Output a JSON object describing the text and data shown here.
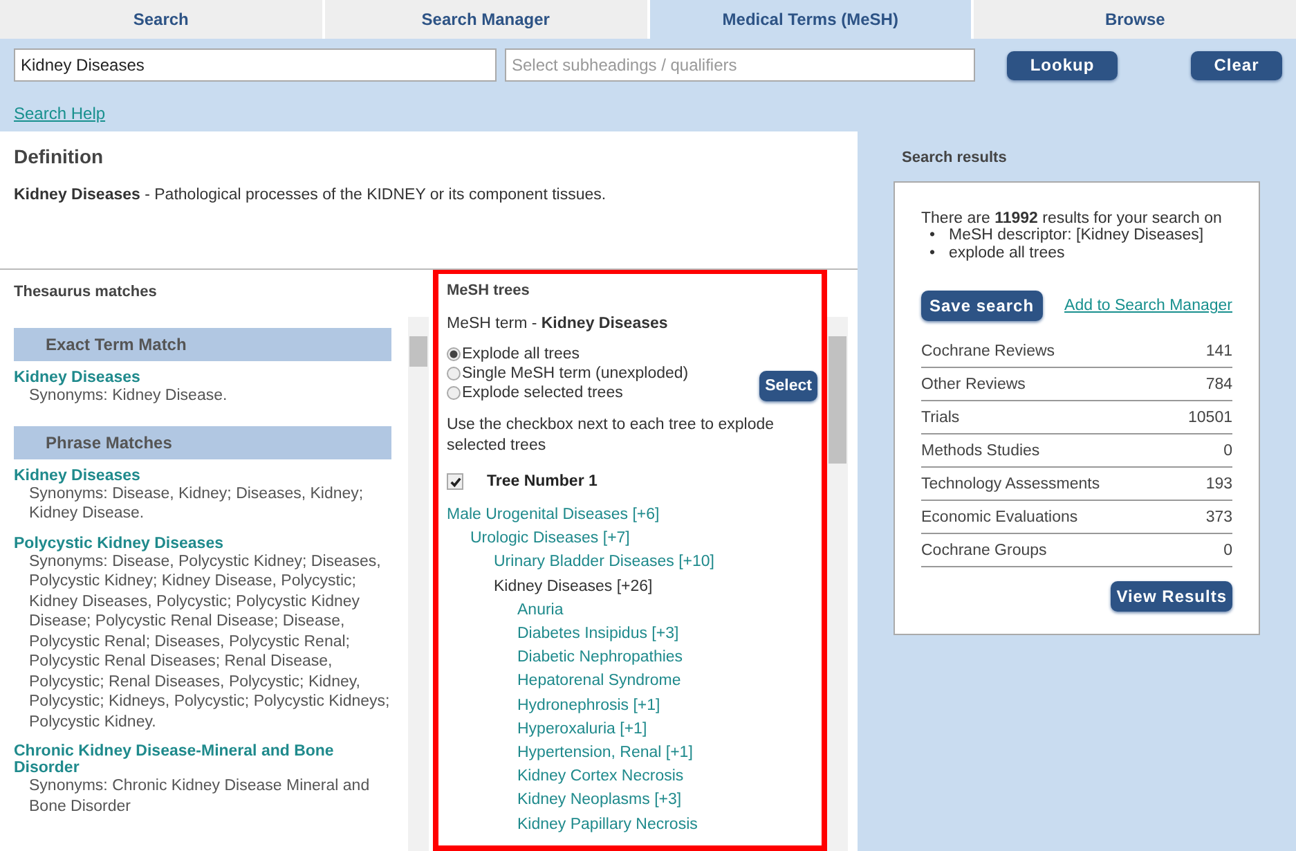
{
  "tabs": [
    {
      "label": "Search",
      "selected": false
    },
    {
      "label": "Search Manager",
      "selected": false
    },
    {
      "label": "Medical Terms (MeSH)",
      "selected": true
    },
    {
      "label": "Browse",
      "selected": false
    }
  ],
  "search": {
    "term": "Kidney Diseases",
    "qualifiers_placeholder": "Select subheadings / qualifiers",
    "lookup": "Lookup",
    "clear": "Clear",
    "help": "Search Help"
  },
  "definition": {
    "title": "Definition",
    "term": "Kidney Diseases",
    "text": " - Pathological processes of the KIDNEY or its component tissues."
  },
  "thesaurus": {
    "title": "Thesaurus matches",
    "groups": [
      {
        "heading": "Exact Term Match",
        "items": [
          {
            "term": "Kidney Diseases",
            "synonyms": "Synonyms: Kidney Disease."
          }
        ]
      },
      {
        "heading": "Phrase Matches",
        "items": [
          {
            "term": "Kidney Diseases",
            "synonyms": "Synonyms: Disease, Kidney; Diseases, Kidney; Kidney Disease."
          },
          {
            "term": "Polycystic Kidney Diseases",
            "synonyms": "Synonyms: Disease, Polycystic Kidney; Diseases, Polycystic Kidney; Kidney Disease, Polycystic; Kidney Diseases, Polycystic; Polycystic Kidney Disease; Polycystic Renal Disease; Disease, Polycystic Renal; Diseases, Polycystic Renal; Polycystic Renal Diseases; Renal Disease, Polycystic; Renal Diseases, Polycystic; Kidney, Polycystic; Kidneys, Polycystic; Polycystic Kidneys; Polycystic Kidney."
          },
          {
            "term": "Chronic Kidney Disease-Mineral and Bone Disorder",
            "synonyms": "Synonyms: Chronic Kidney Disease Mineral and Bone Disorder"
          }
        ]
      }
    ]
  },
  "mesh_trees": {
    "title": "MeSH trees",
    "term_label": "MeSH term - ",
    "term": "Kidney Diseases",
    "options": [
      {
        "label": "Explode all trees",
        "selected": true
      },
      {
        "label": "Single MeSH term (unexploded)",
        "selected": false
      },
      {
        "label": "Explode selected trees",
        "selected": false
      }
    ],
    "select": "Select",
    "hint": "Use the checkbox next to each tree to explode selected trees",
    "tree_label": "Tree Number 1",
    "tree_checked": true,
    "tree": [
      {
        "label": "Male Urogenital Diseases [+6]",
        "current": false,
        "children": [
          {
            "label": "Urologic Diseases [+7]",
            "current": false,
            "children": [
              {
                "label": "Urinary Bladder Diseases [+10]",
                "current": false
              },
              {
                "label": "Kidney Diseases [+26]",
                "current": true,
                "children": [
                  {
                    "label": "Anuria",
                    "current": false
                  },
                  {
                    "label": "Diabetes Insipidus [+3]",
                    "current": false
                  },
                  {
                    "label": "Diabetic Nephropathies",
                    "current": false
                  },
                  {
                    "label": "Hepatorenal Syndrome",
                    "current": false
                  },
                  {
                    "label": "Hydronephrosis [+1]",
                    "current": false
                  },
                  {
                    "label": "Hyperoxaluria [+1]",
                    "current": false
                  },
                  {
                    "label": "Hypertension, Renal [+1]",
                    "current": false
                  },
                  {
                    "label": "Kidney Cortex Necrosis",
                    "current": false
                  },
                  {
                    "label": "Kidney Neoplasms [+3]",
                    "current": false
                  },
                  {
                    "label": "Kidney Papillary Necrosis",
                    "current": false
                  }
                ]
              }
            ]
          }
        ]
      }
    ]
  },
  "results": {
    "title": "Search results",
    "summary": "There are **11992** results for your search on",
    "bullets": [
      {
        "marker": "•",
        "text": "MeSH descriptor: [Kidney Diseases]"
      },
      {
        "marker": "•",
        "text": "explode all trees"
      }
    ],
    "save": "Save search",
    "add": "Add to Search Manager",
    "rows": [
      {
        "label": "Cochrane Reviews",
        "count": "141"
      },
      {
        "label": "Other Reviews",
        "count": "784"
      },
      {
        "label": "Trials",
        "count": "10501"
      },
      {
        "label": "Methods Studies",
        "count": "0"
      },
      {
        "label": "Technology Assessments",
        "count": "193"
      },
      {
        "label": "Economic Evaluations",
        "count": "373"
      },
      {
        "label": "Cochrane Groups",
        "count": "0"
      }
    ],
    "view": "View Results"
  }
}
